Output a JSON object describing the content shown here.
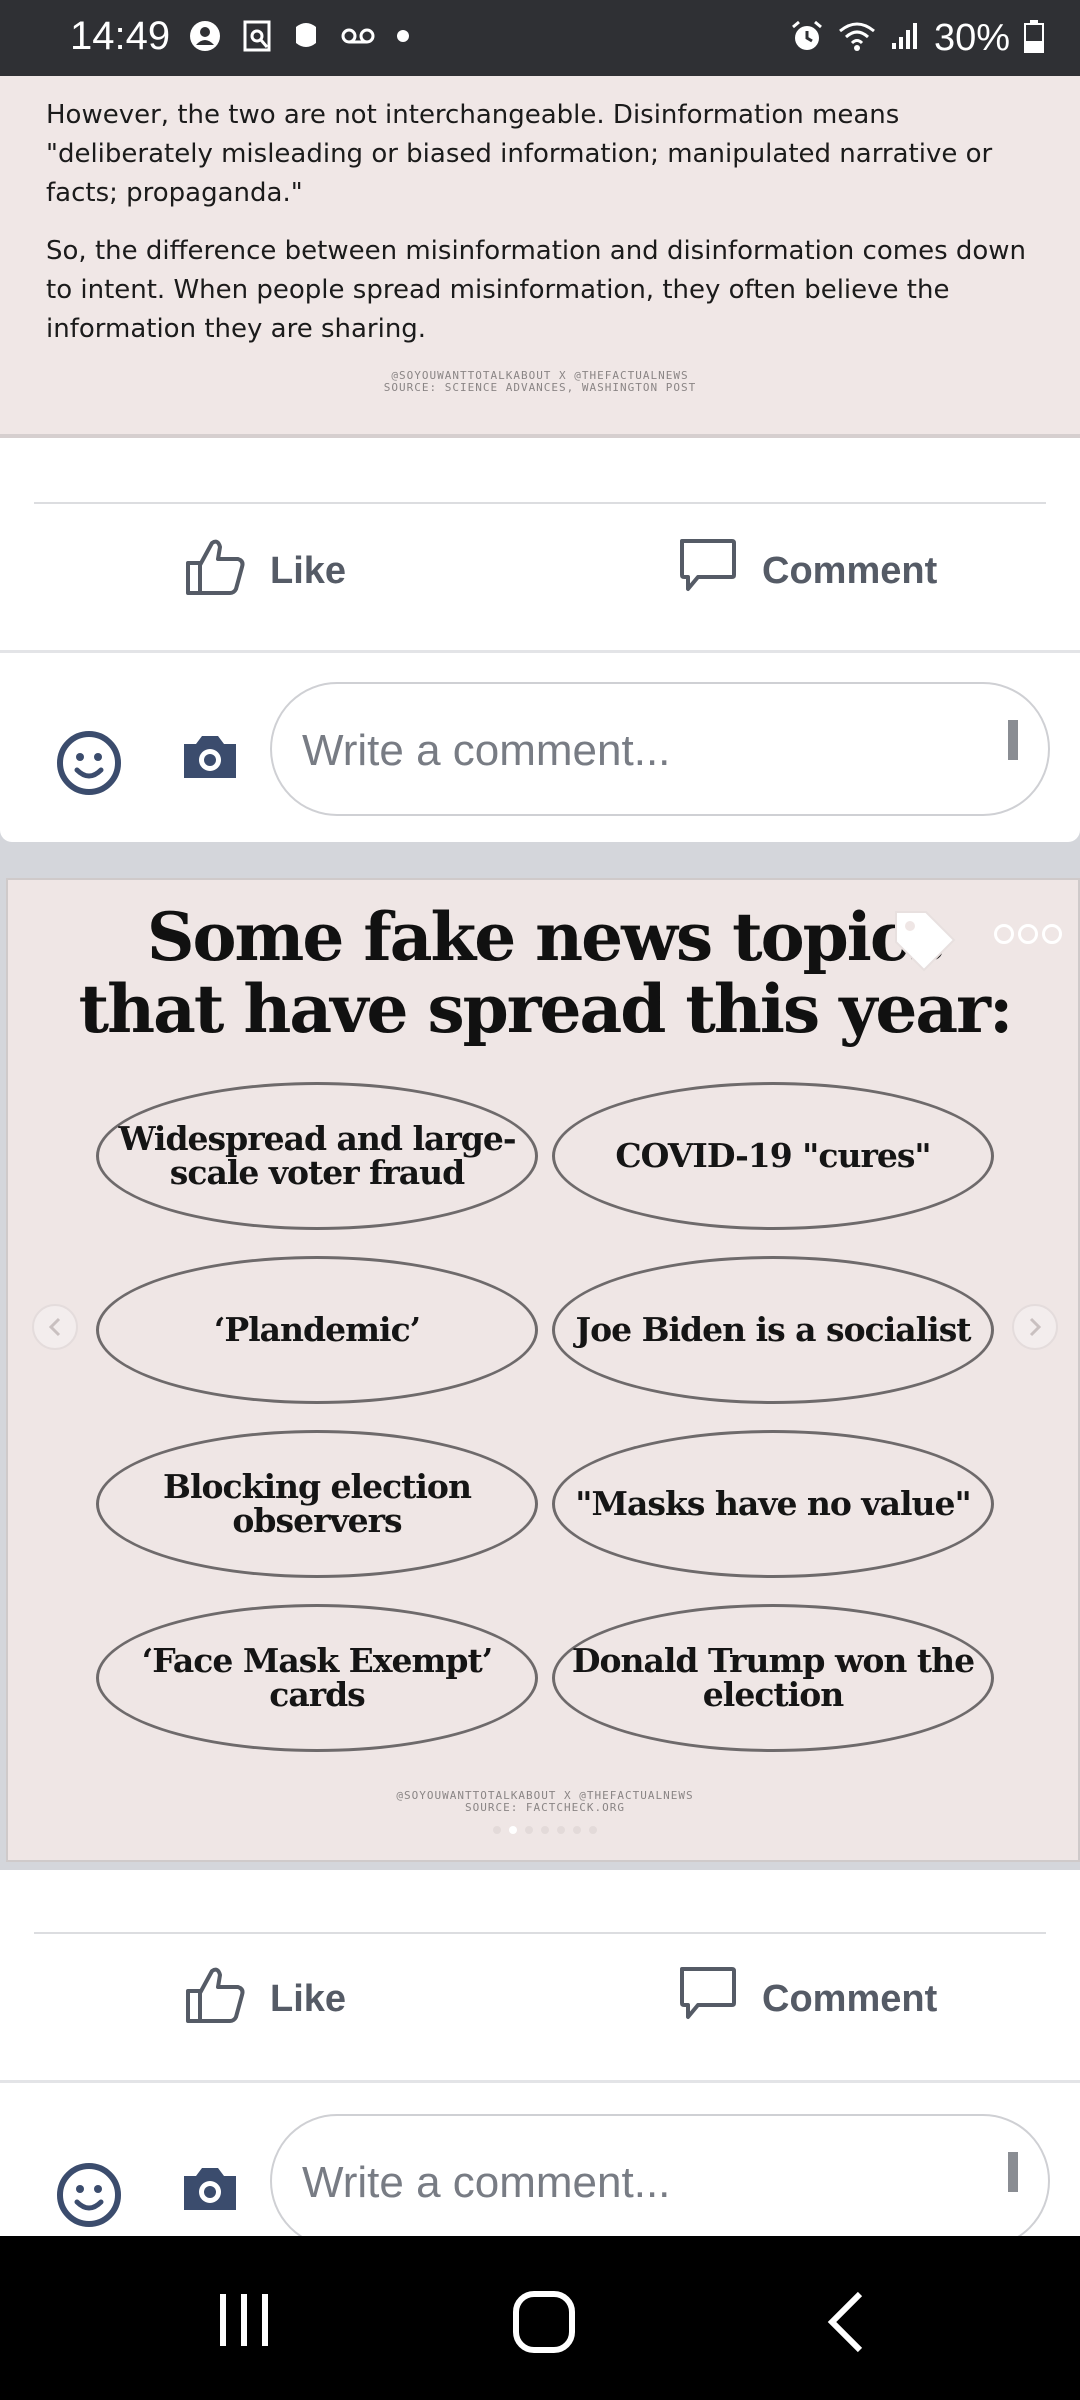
{
  "status_bar": {
    "time": "14:49",
    "battery": "30%"
  },
  "post1": {
    "paragraph1": "However, the two are not interchangeable. Disinformation means \"deliberately misleading or biased information; manipulated narrative or facts; propaganda.\"",
    "paragraph2": "So, the difference between misinformation and disinformation comes down to intent. When people spread misinformation, they often believe the information they are sharing.",
    "credit_line1": "@SOYOUWANTTOTALKABOUT X @THEFACTUALNEWS",
    "credit_line2": "SOURCE: SCIENCE ADVANCES, WASHINGTON POST",
    "like_label": "Like",
    "comment_label": "Comment",
    "comment_placeholder": "Write a comment..."
  },
  "post2": {
    "headline_line1": "Some fake news topics",
    "headline_line2": "that have spread this year:",
    "topics": [
      "Widespread and large-scale voter fraud",
      "COVID-19 \"cures\"",
      "‘Plandemic’",
      "Joe Biden is a socialist",
      "Blocking election observers",
      "\"Masks have no value\"",
      "‘Face Mask Exempt’ cards",
      "Donald Trump won the election"
    ],
    "credit_line1": "@SOYOUWANTTOTALKABOUT X @THEFACTUALNEWS",
    "credit_line2": "SOURCE: FACTCHECK.ORG",
    "like_label": "Like",
    "comment_label": "Comment",
    "comment_placeholder": "Write a comment..."
  },
  "colors": {
    "status_bar": "#2f3034",
    "card_background": "#efe6e5",
    "action_text": "#555b66",
    "icon_blue": "#3b4c6d"
  },
  "icons": {
    "status": [
      "sync-icon",
      "screenshot-icon",
      "app-icon",
      "voicemail-icon",
      "dot-icon",
      "alarm-icon",
      "wifi-icon",
      "signal-icon",
      "battery-icon"
    ],
    "actions": [
      "like-icon",
      "comment-icon",
      "emoji-icon",
      "camera-icon"
    ],
    "nav": [
      "recents-icon",
      "home-icon",
      "back-icon"
    ]
  }
}
